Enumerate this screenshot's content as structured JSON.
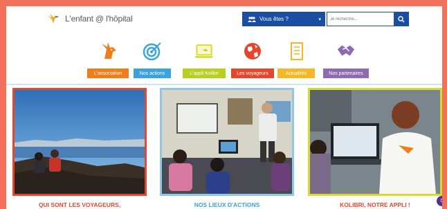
{
  "header": {
    "logo_text": "L'enfant @ l'hôpital",
    "who_button": "Vous êtes ?",
    "search_placeholder": "Je recherche..."
  },
  "nav": [
    {
      "label": "L'association",
      "color": "#f07c1a",
      "icon": "unicorn-icon"
    },
    {
      "label": "Nos actions",
      "color": "#3aa2dd",
      "icon": "target-icon"
    },
    {
      "label": "L'appli Kolibri",
      "color": "#b9cf1f",
      "icon": "laptop-icon"
    },
    {
      "label": "Les voyageurs",
      "color": "#e6462d",
      "icon": "globe-icon"
    },
    {
      "label": "Actualités",
      "color": "#f5b724",
      "icon": "newspaper-icon"
    },
    {
      "label": "Nos partenaires",
      "color": "#8e6bb0",
      "icon": "handshake-icon"
    }
  ],
  "cards": [
    {
      "title": "QUI SONT LES VOYAGEURS,",
      "color": "#e6462d",
      "title_color": "#e6462d"
    },
    {
      "title": "NOS LIEUX D'ACTIONS",
      "color": "#8fc7e8",
      "title_color": "#3aa2dd"
    },
    {
      "title": "KOLIBRI, NOTRE APPLI !",
      "color": "#d6dc2a",
      "title_color": "#e6462d"
    }
  ],
  "badge": "0"
}
